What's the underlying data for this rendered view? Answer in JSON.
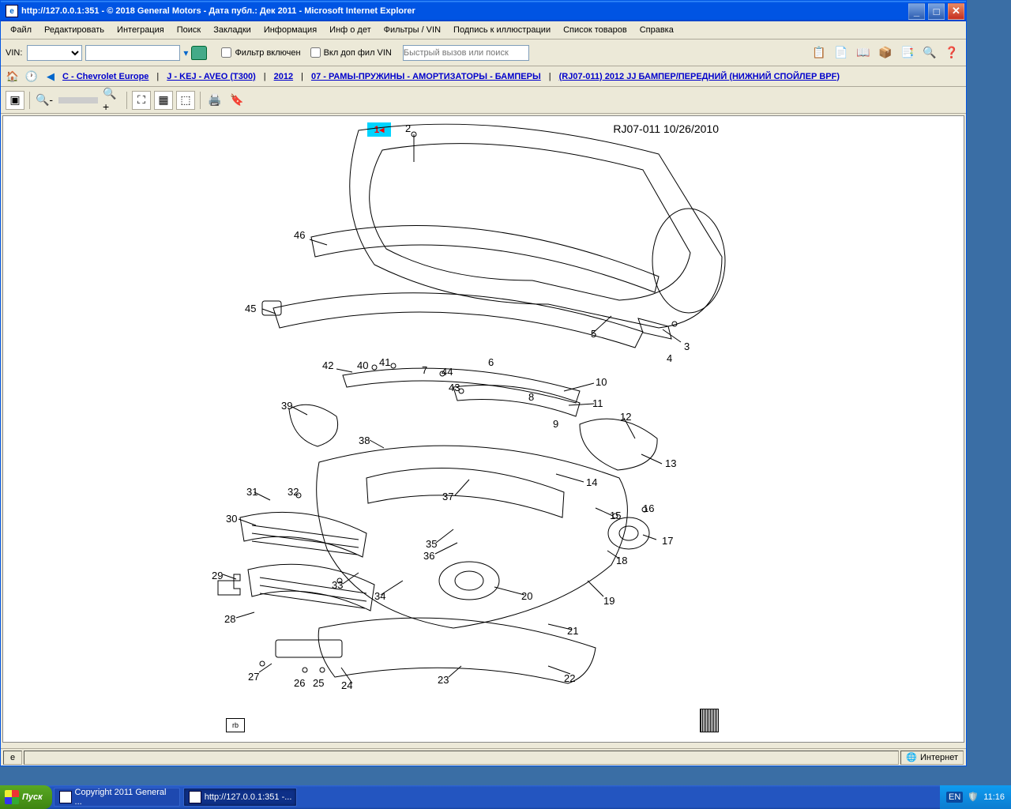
{
  "window": {
    "title": "http://127.0.0.1:351 - © 2018 General Motors - Дата публ.: Дек 2011 - Microsoft Internet Explorer"
  },
  "menu": {
    "file": "Файл",
    "edit": "Редактировать",
    "integration": "Интеграция",
    "search": "Поиск",
    "bookmarks": "Закладки",
    "information": "Информация",
    "infodet": "Инф о дет",
    "filtersvin": "Фильтры / VIN",
    "signature": "Подпись к иллюстрации",
    "productlist": "Список товаров",
    "help": "Справка"
  },
  "filterbar": {
    "vinlabel": "VIN:",
    "vinvalue": "",
    "filteron": "Фильтр включен",
    "addfilvin": "Вкл доп фил VIN",
    "quickplaceholder": "Быстрый вызов или поиск"
  },
  "breadcrumb": {
    "b1": "C - Chevrolet Europe",
    "b2": "J - KEJ - AVEO (T300)",
    "b3": "2012",
    "b4": "07 - РАМЫ-ПРУЖИНЫ - АМОРТИЗАТОРЫ - БАМПЕРЫ",
    "b5": "(RJ07-011)   2012   JJ БАМПЕР/ПЕРЕДНИЙ (НИЖНИЙ СПОЙЛЕР BPF)"
  },
  "diagram": {
    "title": "RJ07-011  10/26/2010",
    "date": "10/26/2010",
    "highlight_num": "1",
    "rb": "rb",
    "callouts": {
      "2": "2",
      "3": "3",
      "4": "4",
      "5": "5",
      "6": "6",
      "7": "7",
      "8": "8",
      "9": "9",
      "10": "10",
      "11": "11",
      "12": "12",
      "13": "13",
      "14": "14",
      "15": "15",
      "16": "16",
      "17": "17",
      "18": "18",
      "19": "19",
      "20": "20",
      "21": "21",
      "22": "22",
      "23": "23",
      "24": "24",
      "25": "25",
      "26": "26",
      "27": "27",
      "28": "28",
      "29": "29",
      "30": "30",
      "31": "31",
      "32": "32",
      "33": "33",
      "34": "34",
      "35": "35",
      "36": "36",
      "37": "37",
      "38": "38",
      "39": "39",
      "40": "40",
      "41": "41",
      "42": "42",
      "43": "43",
      "44": "44",
      "45": "45",
      "46": "46"
    }
  },
  "statusbar": {
    "zone": "Интернет"
  },
  "taskbar": {
    "start": "Пуск",
    "task1": "Copyright 2011 General ...",
    "task2": "http://127.0.0.1:351 -...",
    "lang": "EN",
    "time": "11:16"
  }
}
